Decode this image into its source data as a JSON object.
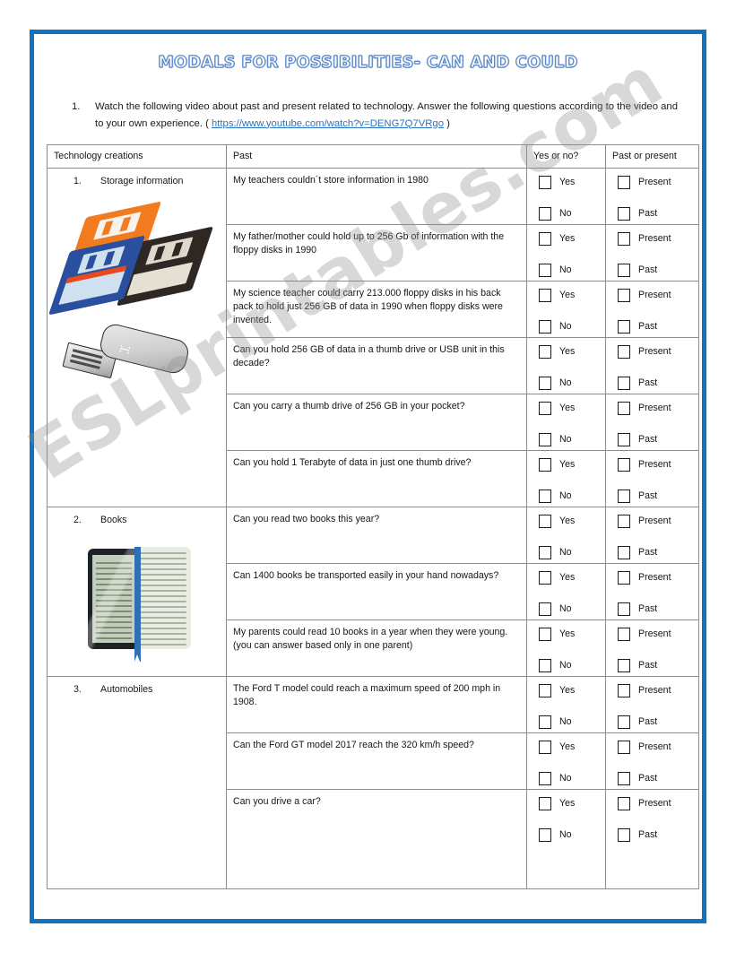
{
  "page": {
    "border_color": "#1272c0",
    "watermark": "ESLprintables.com"
  },
  "title": "MODALS FOR POSSIBILITIES- CAN AND COULD",
  "instruction": {
    "number": "1.",
    "text_before": "Watch the following video about past and present related to technology. Answer the following questions according to the video and to your own experience. ( ",
    "link": "https://www.youtube.com/watch?v=DENG7Q7VRgo",
    "text_after": " )"
  },
  "table": {
    "headers": {
      "technology": "Technology creations",
      "past": "Past",
      "yesno": "Yes or no?",
      "pastpresent": "Past or present"
    },
    "yes_label": "Yes",
    "no_label": "No",
    "present_label": "Present",
    "past_label": "Past",
    "sections": [
      {
        "number": "1.",
        "name": "Storage information",
        "artwork": [
          "floppy-disks",
          "usb-thumb-drive"
        ],
        "questions": [
          "My teachers couldn´t store information in 1980",
          "My father/mother could hold up to 256 Gb of information with the floppy disks in 1990",
          "My science teacher could carry 213.000 floppy disks in his back pack to hold just 256 GB of data in 1990 when floppy disks were invented.",
          "Can you hold 256 GB of data in a thumb drive or USB unit in this decade?",
          "Can you carry a thumb drive of 256 GB in your pocket?",
          "Can you hold 1 Terabyte of data in just one thumb drive?"
        ]
      },
      {
        "number": "2.",
        "name": "Books",
        "artwork": [
          "book-ereader"
        ],
        "questions": [
          "Can you read two books this year?",
          "Can 1400 books be transported easily in your hand nowadays?",
          "My parents could read 10 books in a year when they were young. (you can answer based only in one parent)"
        ]
      },
      {
        "number": "3.",
        "name": "Automobiles",
        "artwork": [],
        "questions": [
          "The Ford T model could reach a maximum speed of 200 mph in 1908.",
          "Can the Ford GT model 2017 reach the 320 km/h speed?",
          "Can you drive a car?"
        ]
      }
    ]
  }
}
